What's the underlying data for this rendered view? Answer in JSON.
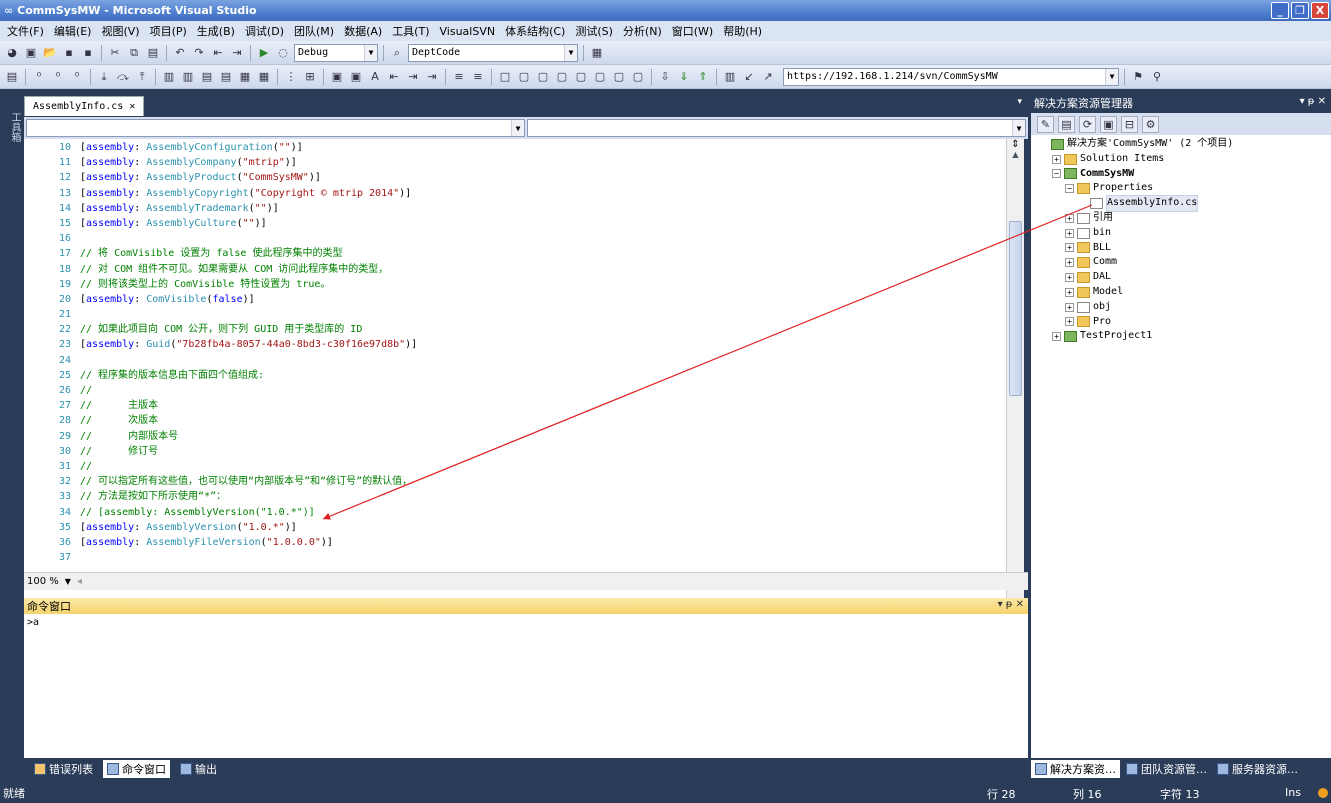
{
  "window": {
    "title": "CommSysMW - Microsoft Visual Studio",
    "minimize": "_",
    "maximize": "❐",
    "close": "X"
  },
  "menu": [
    "文件(F)",
    "编辑(E)",
    "视图(V)",
    "项目(P)",
    "生成(B)",
    "调试(D)",
    "团队(M)",
    "数据(A)",
    "工具(T)",
    "VisualSVN",
    "体系结构(C)",
    "测试(S)",
    "分析(N)",
    "窗口(W)",
    "帮助(H)"
  ],
  "toolbar": {
    "config": "Debug",
    "find": "DeptCode",
    "svn_url": "https://192.168.1.214/svn/CommSysMW"
  },
  "left_strip": {
    "label": "工具箱"
  },
  "editor": {
    "tab": "AssemblyInfo.cs",
    "tab_close": "✕",
    "zoom": "100 %",
    "lines": [
      {
        "n": "10",
        "parts": [
          [
            "tx",
            "["
          ],
          [
            "kw",
            "assembly"
          ],
          [
            "tx",
            ": "
          ],
          [
            "ty",
            "AssemblyConfiguration"
          ],
          [
            "tx",
            "("
          ],
          [
            "st",
            "\"\""
          ],
          [
            "tx",
            ")]"
          ]
        ]
      },
      {
        "n": "11",
        "parts": [
          [
            "tx",
            "["
          ],
          [
            "kw",
            "assembly"
          ],
          [
            "tx",
            ": "
          ],
          [
            "ty",
            "AssemblyCompany"
          ],
          [
            "tx",
            "("
          ],
          [
            "st",
            "\"mtrip\""
          ],
          [
            "tx",
            ")]"
          ]
        ]
      },
      {
        "n": "12",
        "parts": [
          [
            "tx",
            "["
          ],
          [
            "kw",
            "assembly"
          ],
          [
            "tx",
            ": "
          ],
          [
            "ty",
            "AssemblyProduct"
          ],
          [
            "tx",
            "("
          ],
          [
            "st",
            "\"CommSysMW\""
          ],
          [
            "tx",
            ")]"
          ]
        ]
      },
      {
        "n": "13",
        "parts": [
          [
            "tx",
            "["
          ],
          [
            "kw",
            "assembly"
          ],
          [
            "tx",
            ": "
          ],
          [
            "ty",
            "AssemblyCopyright"
          ],
          [
            "tx",
            "("
          ],
          [
            "st",
            "\"Copyright © mtrip 2014\""
          ],
          [
            "tx",
            ")]"
          ]
        ]
      },
      {
        "n": "14",
        "parts": [
          [
            "tx",
            "["
          ],
          [
            "kw",
            "assembly"
          ],
          [
            "tx",
            ": "
          ],
          [
            "ty",
            "AssemblyTrademark"
          ],
          [
            "tx",
            "("
          ],
          [
            "st",
            "\"\""
          ],
          [
            "tx",
            ")]"
          ]
        ]
      },
      {
        "n": "15",
        "parts": [
          [
            "tx",
            "["
          ],
          [
            "kw",
            "assembly"
          ],
          [
            "tx",
            ": "
          ],
          [
            "ty",
            "AssemblyCulture"
          ],
          [
            "tx",
            "("
          ],
          [
            "st",
            "\"\""
          ],
          [
            "tx",
            ")]"
          ]
        ]
      },
      {
        "n": "16",
        "parts": []
      },
      {
        "n": "17",
        "parts": [
          [
            "cm",
            "// 将 ComVisible 设置为 false 使此程序集中的类型"
          ]
        ]
      },
      {
        "n": "18",
        "parts": [
          [
            "cm",
            "// 对 COM 组件不可见。如果需要从 COM 访问此程序集中的类型，"
          ]
        ]
      },
      {
        "n": "19",
        "parts": [
          [
            "cm",
            "// 则将该类型上的 ComVisible 特性设置为 true。"
          ]
        ]
      },
      {
        "n": "20",
        "parts": [
          [
            "tx",
            "["
          ],
          [
            "kw",
            "assembly"
          ],
          [
            "tx",
            ": "
          ],
          [
            "ty",
            "ComVisible"
          ],
          [
            "tx",
            "("
          ],
          [
            "kw",
            "false"
          ],
          [
            "tx",
            ")]"
          ]
        ]
      },
      {
        "n": "21",
        "parts": []
      },
      {
        "n": "22",
        "parts": [
          [
            "cm",
            "// 如果此项目向 COM 公开，则下列 GUID 用于类型库的 ID"
          ]
        ]
      },
      {
        "n": "23",
        "parts": [
          [
            "tx",
            "["
          ],
          [
            "kw",
            "assembly"
          ],
          [
            "tx",
            ": "
          ],
          [
            "ty",
            "Guid"
          ],
          [
            "tx",
            "("
          ],
          [
            "st",
            "\"7b28fb4a-8057-44a0-8bd3-c30f16e97d8b\""
          ],
          [
            "tx",
            ")]"
          ]
        ]
      },
      {
        "n": "24",
        "parts": []
      },
      {
        "n": "25",
        "parts": [
          [
            "cm",
            "// 程序集的版本信息由下面四个值组成:"
          ]
        ]
      },
      {
        "n": "26",
        "parts": [
          [
            "cm",
            "//"
          ]
        ]
      },
      {
        "n": "27",
        "parts": [
          [
            "cm",
            "//      主版本"
          ]
        ]
      },
      {
        "n": "28",
        "parts": [
          [
            "cm",
            "//      次版本"
          ]
        ]
      },
      {
        "n": "29",
        "parts": [
          [
            "cm",
            "//      内部版本号"
          ]
        ]
      },
      {
        "n": "30",
        "parts": [
          [
            "cm",
            "//      修订号"
          ]
        ]
      },
      {
        "n": "31",
        "parts": [
          [
            "cm",
            "//"
          ]
        ]
      },
      {
        "n": "32",
        "parts": [
          [
            "cm",
            "// 可以指定所有这些值，也可以使用“内部版本号”和“修订号”的默认值，"
          ]
        ]
      },
      {
        "n": "33",
        "parts": [
          [
            "cm",
            "// 方法是按如下所示使用“*”："
          ]
        ]
      },
      {
        "n": "34",
        "parts": [
          [
            "cm",
            "// [assembly: AssemblyVersion(\"1.0.*\")]"
          ]
        ]
      },
      {
        "n": "35",
        "parts": [
          [
            "tx",
            "["
          ],
          [
            "kw",
            "assembly"
          ],
          [
            "tx",
            ": "
          ],
          [
            "ty",
            "AssemblyVersion"
          ],
          [
            "tx",
            "("
          ],
          [
            "st",
            "\"1.0.*\""
          ],
          [
            "tx",
            ")]"
          ]
        ]
      },
      {
        "n": "36",
        "parts": [
          [
            "tx",
            "["
          ],
          [
            "kw",
            "assembly"
          ],
          [
            "tx",
            ": "
          ],
          [
            "ty",
            "AssemblyFileVersion"
          ],
          [
            "tx",
            "("
          ],
          [
            "st",
            "\"1.0.0.0\""
          ],
          [
            "tx",
            ")]"
          ]
        ]
      },
      {
        "n": "37",
        "parts": []
      }
    ]
  },
  "command_window": {
    "title": "命令窗口",
    "controls": "▾ ᵽ ✕",
    "prompt": ">",
    "input": "a"
  },
  "bottom_tabs": [
    "错误列表",
    "命令窗口",
    "输出"
  ],
  "solution_explorer": {
    "title": "解决方案资源管理器",
    "controls": "▾ ᵽ ✕",
    "nodes": [
      {
        "label": "解决方案'CommSysMW' (2 个项目)",
        "lvl": 0,
        "pm": "",
        "ic": "proj",
        "bold": false
      },
      {
        "label": "Solution Items",
        "lvl": 1,
        "pm": "+",
        "ic": "folder",
        "bold": false
      },
      {
        "label": "CommSysMW",
        "lvl": 1,
        "pm": "−",
        "ic": "proj",
        "bold": true
      },
      {
        "label": "Properties",
        "lvl": 2,
        "pm": "−",
        "ic": "folder",
        "bold": false
      },
      {
        "label": "AssemblyInfo.cs",
        "lvl": 3,
        "pm": "",
        "ic": "file",
        "bold": false,
        "selected": true
      },
      {
        "label": "引用",
        "lvl": 2,
        "pm": "+",
        "ic": "file",
        "bold": false
      },
      {
        "label": "bin",
        "lvl": 2,
        "pm": "+",
        "ic": "file",
        "bold": false
      },
      {
        "label": "BLL",
        "lvl": 2,
        "pm": "+",
        "ic": "folder",
        "bold": false
      },
      {
        "label": "Comm",
        "lvl": 2,
        "pm": "+",
        "ic": "folder",
        "bold": false
      },
      {
        "label": "DAL",
        "lvl": 2,
        "pm": "+",
        "ic": "folder",
        "bold": false
      },
      {
        "label": "Model",
        "lvl": 2,
        "pm": "+",
        "ic": "folder",
        "bold": false
      },
      {
        "label": "obj",
        "lvl": 2,
        "pm": "+",
        "ic": "file",
        "bold": false
      },
      {
        "label": "Pro",
        "lvl": 2,
        "pm": "+",
        "ic": "folder",
        "bold": false
      },
      {
        "label": "TestProject1",
        "lvl": 1,
        "pm": "+",
        "ic": "proj",
        "bold": false
      }
    ],
    "tabs": [
      "解决方案资…",
      "团队资源管…",
      "服务器资源…"
    ]
  },
  "status": {
    "ready": "就绪",
    "line": "行 28",
    "col": "列 16",
    "ch": "字符 13",
    "mode": "Ins"
  },
  "colors": {
    "chrome": "#2b3c59",
    "annotation_arrow": "#e02020"
  }
}
